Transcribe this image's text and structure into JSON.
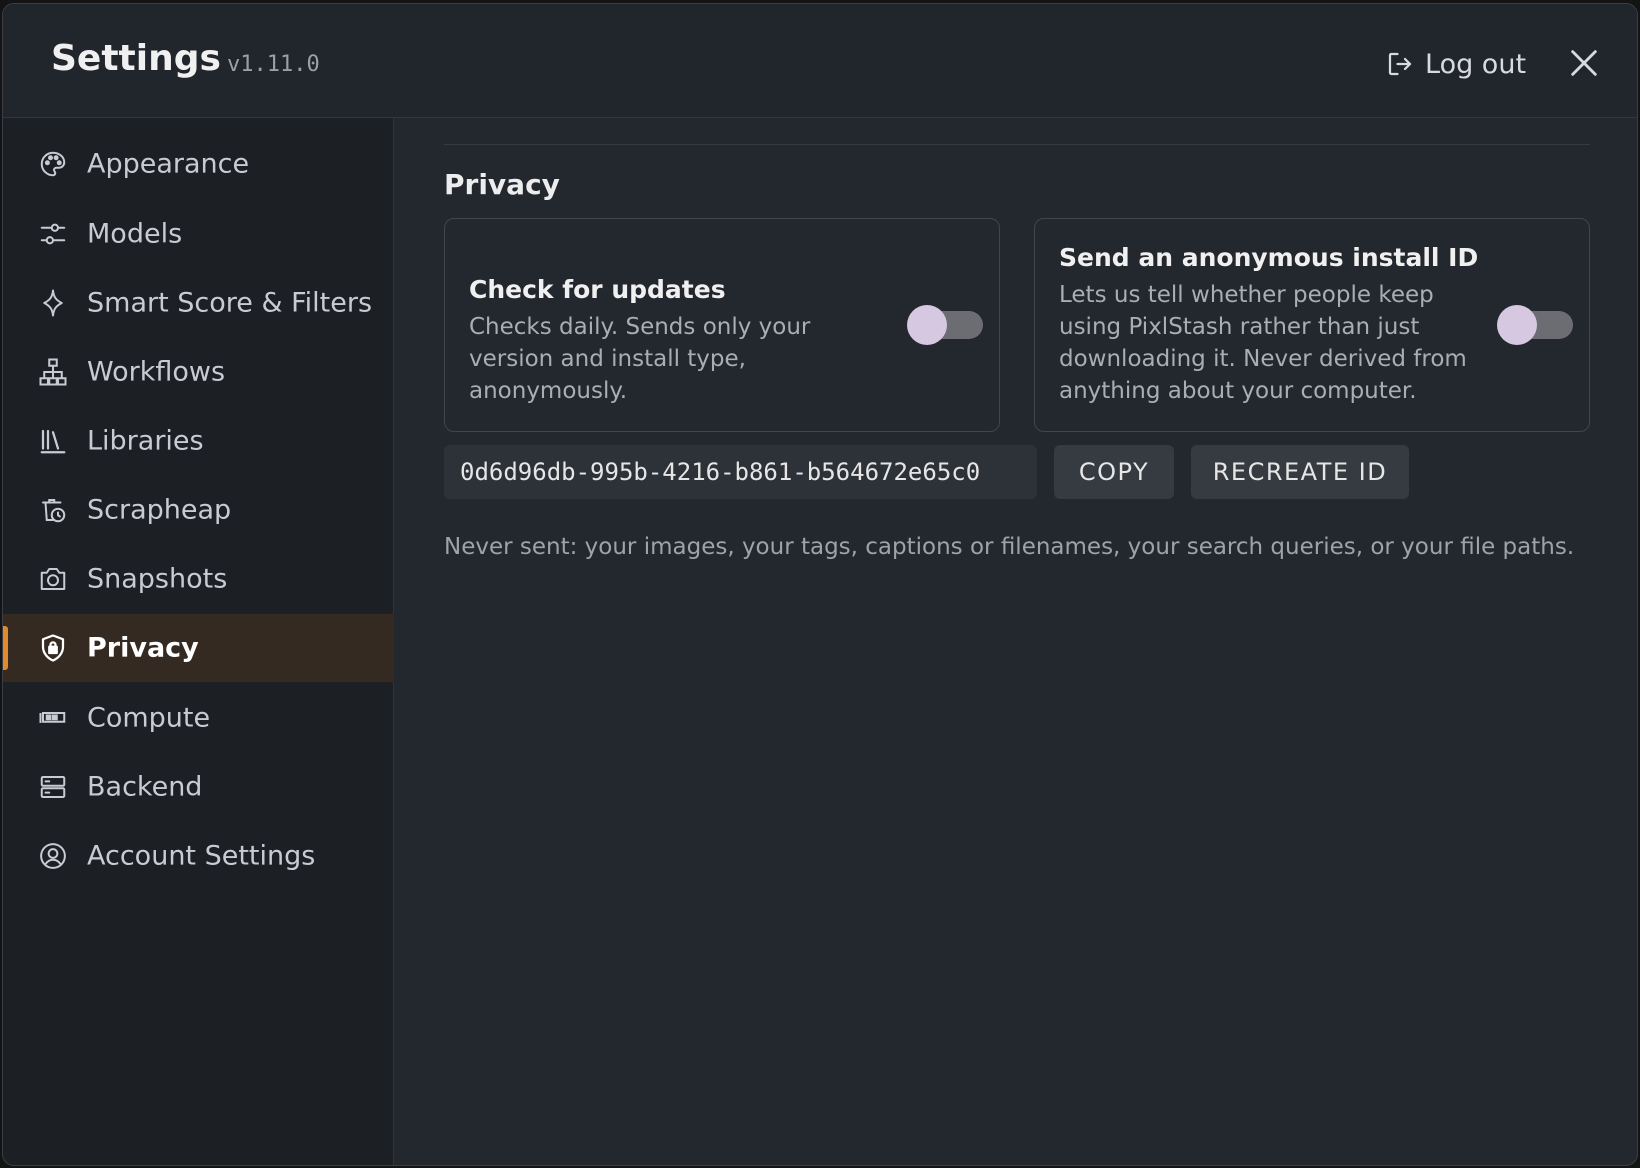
{
  "header": {
    "title": "Settings",
    "version": "v1.11.0",
    "logout_label": "Log out"
  },
  "sidebar": {
    "items": [
      {
        "label": "Appearance",
        "icon": "palette-icon"
      },
      {
        "label": "Models",
        "icon": "sliders-icon"
      },
      {
        "label": "Smart Score & Filters",
        "icon": "sparkle-icon"
      },
      {
        "label": "Workflows",
        "icon": "sitemap-icon"
      },
      {
        "label": "Libraries",
        "icon": "library-icon"
      },
      {
        "label": "Scrapheap",
        "icon": "bin-clock-icon"
      },
      {
        "label": "Snapshots",
        "icon": "camera-icon"
      },
      {
        "label": "Privacy",
        "icon": "shield-lock-icon",
        "active": true
      },
      {
        "label": "Compute",
        "icon": "chip-icon"
      },
      {
        "label": "Backend",
        "icon": "server-icon"
      },
      {
        "label": "Account Settings",
        "icon": "user-circle-icon"
      }
    ]
  },
  "privacy": {
    "section_title": "Privacy",
    "updates_card": {
      "title": "Check for updates",
      "description": "Checks daily. Sends only your version and install type, anonymously.",
      "enabled": false
    },
    "install_id_card": {
      "title": "Send an anonymous install ID",
      "description": "Lets us tell whether people keep using PixlStash rather than just downloading it. Never derived from anything about your computer.",
      "enabled": false
    },
    "install_id_value": "0d6d96db-995b-4216-b861-b564672e65c0",
    "copy_label": "COPY",
    "recreate_label": "RECREATE ID",
    "note": "Never sent: your images, your tags, captions or filenames, your search queries, or your file paths."
  },
  "colors": {
    "accent": "#e08a2c",
    "toggle_knob": "#d6c8e0",
    "background": "#23272e"
  }
}
